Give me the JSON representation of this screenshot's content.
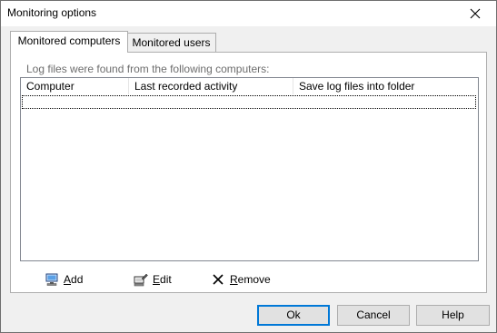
{
  "window": {
    "title": "Monitoring options"
  },
  "tabs": [
    {
      "label": "Monitored computers",
      "active": true
    },
    {
      "label": "Monitored users",
      "active": false
    }
  ],
  "panel": {
    "info_label": "Log files were found from the following computers:",
    "columns": [
      "Computer",
      "Last recorded activity",
      "Save log files into folder"
    ],
    "rows": []
  },
  "toolbar": {
    "add_label": "Add",
    "edit_label": "Edit",
    "remove_label": "Remove"
  },
  "buttons": {
    "ok_label": "Ok",
    "cancel_label": "Cancel",
    "help_label": "Help"
  },
  "colors": {
    "accent": "#0078d7",
    "panel_bg": "#ffffff",
    "dialog_bg": "#f0f0f0"
  }
}
